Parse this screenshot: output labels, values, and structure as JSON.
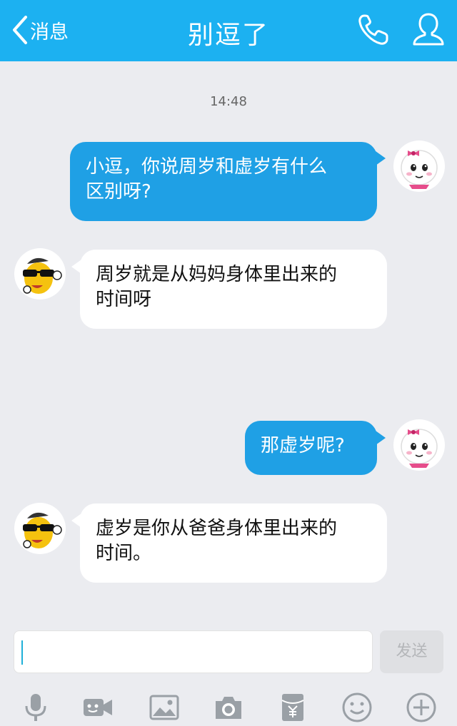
{
  "header": {
    "back_label": "消息",
    "title": "别逗了"
  },
  "chat": {
    "timestamp": "14:48",
    "messages": [
      {
        "sender": "me",
        "line1": "小逗，你说周岁和虚岁有什么",
        "line2": "区别呀?"
      },
      {
        "sender": "bot",
        "line1": "周岁就是从妈妈身体里出来的",
        "line2": "时间呀"
      },
      {
        "sender": "me",
        "line1": "那虚岁呢?"
      },
      {
        "sender": "bot",
        "line1": "虚岁是你从爸爸身体里出来的",
        "line2": "时间。"
      }
    ]
  },
  "input": {
    "value": "",
    "send_label": "发送"
  },
  "toolbar": {
    "items": [
      "microphone-icon",
      "video-icon",
      "image-icon",
      "camera-icon",
      "red-packet-icon",
      "emoji-icon",
      "plus-icon"
    ]
  },
  "colors": {
    "header": "#1cb1f1",
    "bubble_me": "#1fa0e5",
    "bubble_them": "#ffffff",
    "background": "#ebecf0",
    "icon_gray": "#9aa0a6"
  }
}
